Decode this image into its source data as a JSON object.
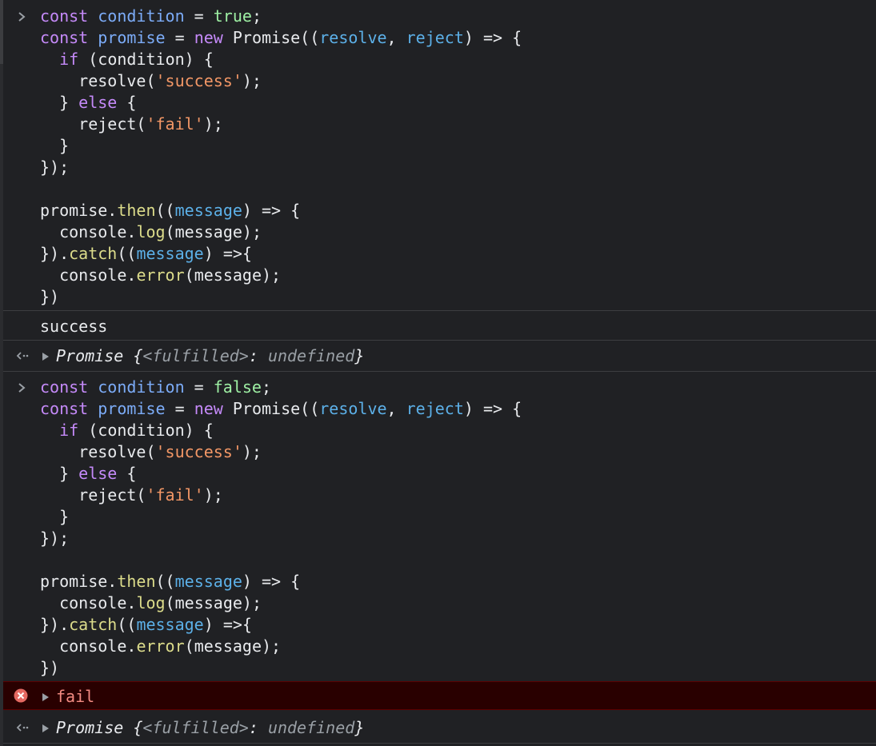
{
  "blocks": [
    {
      "condition_value": "true",
      "log_output": "success",
      "result": {
        "obj": "Promise",
        "open": "{",
        "state": "<fulfilled>",
        "colon": ":",
        "value": "undefined",
        "close": "}"
      }
    },
    {
      "condition_value": "false",
      "error_output": "fail",
      "result": {
        "obj": "Promise",
        "open": "{",
        "state": "<fulfilled>",
        "colon": ":",
        "value": "undefined",
        "close": "}"
      }
    }
  ],
  "code": {
    "kw_const": "const",
    "var_condition": "condition",
    "var_promise": "promise",
    "kw_new": "new",
    "cls_promise": "Promise",
    "p_resolve": "resolve",
    "p_reject": "reject",
    "kw_if": "if",
    "kw_else": "else",
    "str_success": "'success'",
    "str_fail": "'fail'",
    "m_then": "then",
    "m_catch": "catch",
    "p_message": "message",
    "obj_console": "console",
    "m_log": "log",
    "m_error": "error"
  },
  "colors": {
    "background": "#202124",
    "keyword": "#c58af9",
    "variable": "#7cacf8",
    "string": "#f29766",
    "literal": "#9ef0a4",
    "method": "#dcdc8b",
    "error_text": "#f28b82",
    "error_bg": "#290000"
  }
}
